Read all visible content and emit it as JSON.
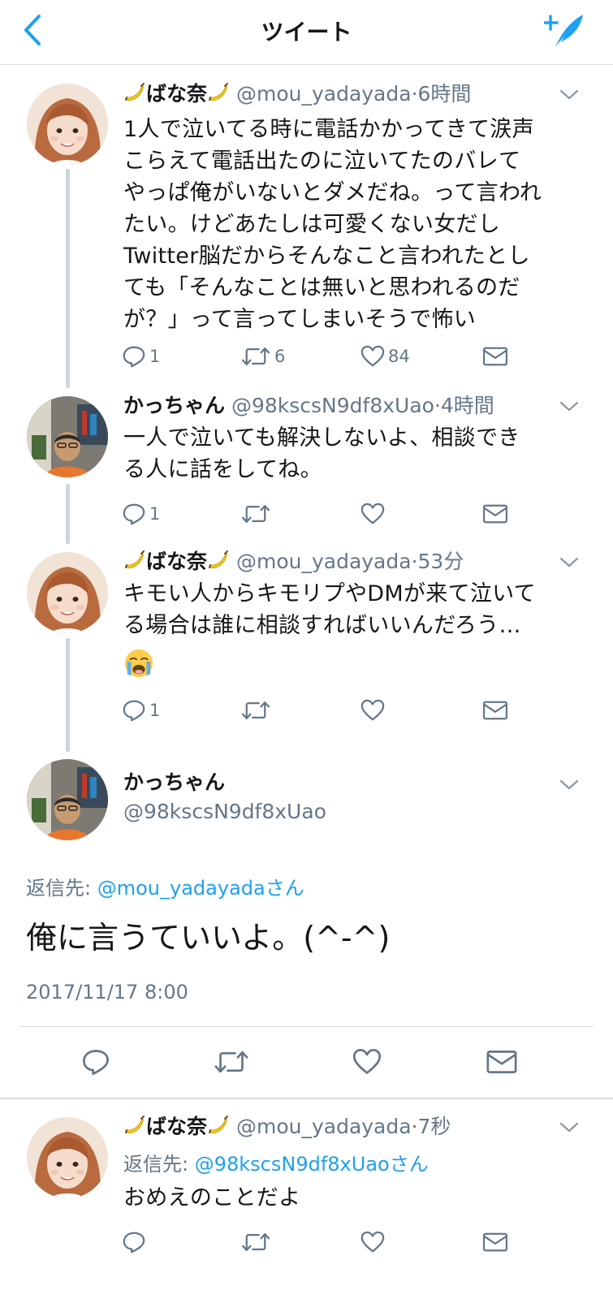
{
  "header": {
    "title": "ツイート"
  },
  "icons": {
    "back": "chevron-left-icon",
    "compose": "compose-tweet-icon",
    "reply": "reply-icon",
    "retweet": "retweet-icon",
    "like": "heart-icon",
    "dm": "envelope-icon",
    "more": "chevron-down-icon",
    "emoji_banana": "banana-emoji",
    "emoji_cry": "loudly-crying-face-emoji"
  },
  "colors": {
    "accent": "#1da1f2",
    "text": "#14171a",
    "muted": "#657786",
    "divider": "#d6dbdf"
  },
  "tweets": [
    {
      "name": "ばな奈",
      "handle": "@mou_yadayada",
      "dot": "·",
      "time": "6時間",
      "lines": [
        "1人で泣いてる時に電話かかってきて涙声",
        "こらえて電話出たのに泣いてたのバレて",
        "やっぱ俺がいないとダメだね。って言われ",
        "たい。けどあたしは可愛くない女だし",
        "Twitter脳だからそんなこと言われたとし",
        "ても「そんなことは無いと思われるのだ",
        "が？」って言ってしまいそうで怖い"
      ],
      "reply_count": "1",
      "retweet_count": "6",
      "like_count": "84"
    },
    {
      "name": "かっちゃん",
      "handle": "@98kscsN9df8xUao",
      "dot": "·",
      "time": "4時間",
      "lines": [
        "一人で泣いても解決しないよ、相談でき",
        "る人に話をしてね。"
      ],
      "reply_count": "1"
    },
    {
      "name": "ばな奈",
      "handle": "@mou_yadayada",
      "dot": "·",
      "time": "53分",
      "lines": [
        "キモい人からキモリプやDMが来て泣いて",
        "る場合は誰に相談すればいいんだろう…"
      ],
      "reply_count": "1"
    }
  ],
  "focused": {
    "name": "かっちゃん",
    "handle": "@98kscsN9df8xUao",
    "reply_to_label": "返信先:",
    "reply_to_user": "@mou_yadayadaさん",
    "text": "俺に言うていいよ。(^-^)",
    "timestamp": "2017/11/17 8:00"
  },
  "last_reply": {
    "name": "ばな奈",
    "handle": "@mou_yadayada",
    "dot": "·",
    "time": "7秒",
    "reply_to_label": "返信先:",
    "reply_to_user": "@98kscsN9df8xUaoさん",
    "text": "おめえのことだよ"
  }
}
